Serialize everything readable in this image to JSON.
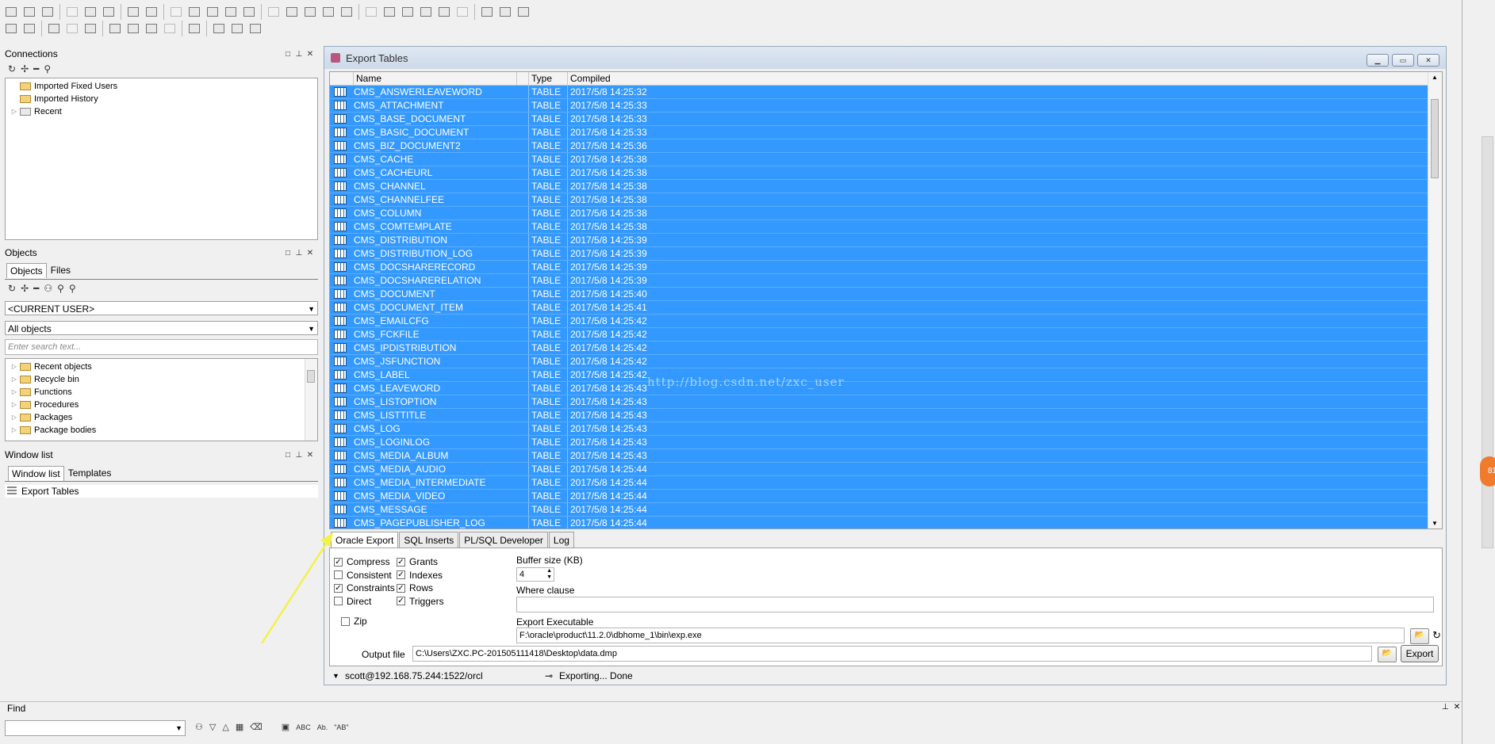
{
  "toolbar": {
    "row1": [
      "new-icon",
      "open-icon",
      "reopen-icon",
      "save-icon",
      "save-as-icon",
      "save-all-icon",
      "print-icon",
      "print-preview-icon",
      "undo-icon",
      "redo-icon",
      "cut-icon",
      "copy-icon",
      "paste-icon",
      "find-icon",
      "replace-icon",
      "toggle-icon",
      "comment-icon",
      "execute-icon",
      "indent-icon",
      "unindent-icon",
      "upper-icon",
      "lower-icon",
      "window-list-icon",
      "grid-icon",
      "oracle-icon",
      "pdf-icon",
      "help-icon"
    ],
    "row2": [
      "key-icon",
      "compile-icon",
      "debug-icon",
      "db-icon",
      "db2-icon",
      "sql-icon",
      "commit-icon",
      "rollback-icon",
      "plan-icon",
      "wrench-icon",
      "arrow-right-icon",
      "arrow-right-red-icon",
      "bookmark-icon"
    ]
  },
  "connections": {
    "title": "Connections",
    "items": [
      {
        "label": "Imported Fixed Users"
      },
      {
        "label": "Imported History"
      },
      {
        "label": "Recent"
      }
    ]
  },
  "objects": {
    "title": "Objects",
    "tabs": [
      "Objects",
      "Files"
    ],
    "user_select": "<CURRENT USER>",
    "filter_select": "All objects",
    "search_placeholder": "Enter search text...",
    "items": [
      {
        "label": "Recent objects"
      },
      {
        "label": "Recycle bin"
      },
      {
        "label": "Functions"
      },
      {
        "label": "Procedures"
      },
      {
        "label": "Packages"
      },
      {
        "label": "Package bodies"
      }
    ]
  },
  "window_list": {
    "title": "Window list",
    "tabs": [
      "Window list",
      "Templates"
    ],
    "items": [
      {
        "label": "Export Tables"
      }
    ]
  },
  "export_window": {
    "title": "Export Tables",
    "columns": [
      "Name",
      "Type",
      "Compiled"
    ],
    "rows": [
      [
        "CMS_ANSWERLEAVEWORD",
        "TABLE",
        "2017/5/8 14:25:32"
      ],
      [
        "CMS_ATTACHMENT",
        "TABLE",
        "2017/5/8 14:25:33"
      ],
      [
        "CMS_BASE_DOCUMENT",
        "TABLE",
        "2017/5/8 14:25:33"
      ],
      [
        "CMS_BASIC_DOCUMENT",
        "TABLE",
        "2017/5/8 14:25:33"
      ],
      [
        "CMS_BIZ_DOCUMENT2",
        "TABLE",
        "2017/5/8 14:25:36"
      ],
      [
        "CMS_CACHE",
        "TABLE",
        "2017/5/8 14:25:38"
      ],
      [
        "CMS_CACHEURL",
        "TABLE",
        "2017/5/8 14:25:38"
      ],
      [
        "CMS_CHANNEL",
        "TABLE",
        "2017/5/8 14:25:38"
      ],
      [
        "CMS_CHANNELFEE",
        "TABLE",
        "2017/5/8 14:25:38"
      ],
      [
        "CMS_COLUMN",
        "TABLE",
        "2017/5/8 14:25:38"
      ],
      [
        "CMS_COMTEMPLATE",
        "TABLE",
        "2017/5/8 14:25:38"
      ],
      [
        "CMS_DISTRIBUTION",
        "TABLE",
        "2017/5/8 14:25:39"
      ],
      [
        "CMS_DISTRIBUTION_LOG",
        "TABLE",
        "2017/5/8 14:25:39"
      ],
      [
        "CMS_DOCSHARERECORD",
        "TABLE",
        "2017/5/8 14:25:39"
      ],
      [
        "CMS_DOCSHARERELATION",
        "TABLE",
        "2017/5/8 14:25:39"
      ],
      [
        "CMS_DOCUMENT",
        "TABLE",
        "2017/5/8 14:25:40"
      ],
      [
        "CMS_DOCUMENT_ITEM",
        "TABLE",
        "2017/5/8 14:25:41"
      ],
      [
        "CMS_EMAILCFG",
        "TABLE",
        "2017/5/8 14:25:42"
      ],
      [
        "CMS_FCKFILE",
        "TABLE",
        "2017/5/8 14:25:42"
      ],
      [
        "CMS_IPDISTRIBUTION",
        "TABLE",
        "2017/5/8 14:25:42"
      ],
      [
        "CMS_JSFUNCTION",
        "TABLE",
        "2017/5/8 14:25:42"
      ],
      [
        "CMS_LABEL",
        "TABLE",
        "2017/5/8 14:25:42"
      ],
      [
        "CMS_LEAVEWORD",
        "TABLE",
        "2017/5/8 14:25:43"
      ],
      [
        "CMS_LISTOPTION",
        "TABLE",
        "2017/5/8 14:25:43"
      ],
      [
        "CMS_LISTTITLE",
        "TABLE",
        "2017/5/8 14:25:43"
      ],
      [
        "CMS_LOG",
        "TABLE",
        "2017/5/8 14:25:43"
      ],
      [
        "CMS_LOGINLOG",
        "TABLE",
        "2017/5/8 14:25:43"
      ],
      [
        "CMS_MEDIA_ALBUM",
        "TABLE",
        "2017/5/8 14:25:43"
      ],
      [
        "CMS_MEDIA_AUDIO",
        "TABLE",
        "2017/5/8 14:25:44"
      ],
      [
        "CMS_MEDIA_INTERMEDIATE",
        "TABLE",
        "2017/5/8 14:25:44"
      ],
      [
        "CMS_MEDIA_VIDEO",
        "TABLE",
        "2017/5/8 14:25:44"
      ],
      [
        "CMS_MESSAGE",
        "TABLE",
        "2017/5/8 14:25:44"
      ],
      [
        "CMS_PAGEPUBLISHER_LOG",
        "TABLE",
        "2017/5/8 14:25:44"
      ]
    ],
    "watermark": "http://blog.csdn.net/zxc_user",
    "tabs": [
      "Oracle Export",
      "SQL Inserts",
      "PL/SQL Developer",
      "Log"
    ],
    "options_col1": [
      {
        "label": "Compress",
        "checked": true
      },
      {
        "label": "Consistent",
        "checked": false
      },
      {
        "label": "Constraints",
        "checked": true
      },
      {
        "label": "Direct",
        "checked": false
      }
    ],
    "options_col2": [
      {
        "label": "Grants",
        "checked": true
      },
      {
        "label": "Indexes",
        "checked": true
      },
      {
        "label": "Rows",
        "checked": true
      },
      {
        "label": "Triggers",
        "checked": true
      }
    ],
    "zip": {
      "label": "Zip",
      "checked": false
    },
    "buffer_label": "Buffer size (KB)",
    "buffer_value": "4",
    "where_label": "Where clause",
    "where_value": "",
    "exec_label": "Export Executable",
    "exec_value": "F:\\oracle\\product\\11.2.0\\dbhome_1\\bin\\exp.exe",
    "output_label": "Output file",
    "output_value": "C:\\Users\\ZXC.PC-201505111418\\Desktop\\data.dmp",
    "export_button": "Export",
    "status_connection": "scott@192.168.75.244:1522/orcl",
    "status_message": "Exporting... Done"
  },
  "find": {
    "title": "Find",
    "value": "",
    "abc1": "ABC",
    "abc2": "Ab.",
    "abc3": "\"AB\""
  },
  "colors": {
    "selection": "#3399ff",
    "annotation_arrow": "#f2f24a"
  }
}
